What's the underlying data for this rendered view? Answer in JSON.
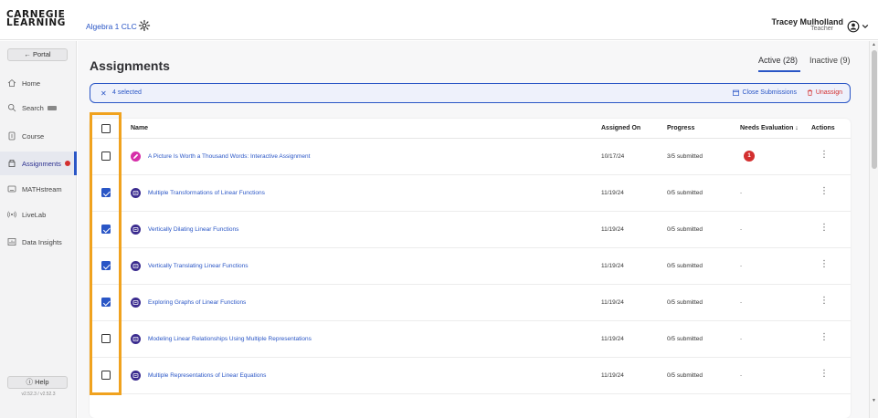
{
  "app": {
    "logo_line1": "CARNEGIE",
    "logo_line2": "LEARNING",
    "course": "Algebra 1 CLC",
    "user_name": "Tracey Mulholland",
    "user_role": "Teacher"
  },
  "sidebar": {
    "portal": "← Portal",
    "items": [
      {
        "label": "Home",
        "icon": "home-icon"
      },
      {
        "label": "Search",
        "icon": "search-icon"
      },
      {
        "label": "Course",
        "icon": "course-icon"
      },
      {
        "label": "Assignments",
        "icon": "assignments-icon",
        "active": true
      },
      {
        "label": "MATHstream",
        "icon": "mathstream-icon"
      },
      {
        "label": "LiveLab",
        "icon": "livelab-icon"
      },
      {
        "label": "Data Insights",
        "icon": "data-insights-icon"
      }
    ],
    "help": "ⓘ Help",
    "version": "v2.52.3 / v2.52.3"
  },
  "main": {
    "title": "Assignments",
    "tabs": [
      {
        "label": "Active (28)",
        "active": true
      },
      {
        "label": "Inactive (9)",
        "active": false
      }
    ],
    "selection": {
      "text": "4 selected",
      "close_label": "Close Submissions",
      "unassign_label": "Unassign"
    },
    "columns": {
      "name": "Name",
      "assigned_on": "Assigned On",
      "progress": "Progress",
      "needs_evaluation": "Needs Evaluation ↓",
      "actions": "Actions"
    },
    "rows": [
      {
        "name": "A Picture Is Worth a Thousand Words: Interactive Assignment",
        "assigned_on": "10/17/24",
        "progress": "3/5 submitted",
        "needs_evaluation": "1",
        "checked": false,
        "icon": "pencil-icon"
      },
      {
        "name": "Multiple Transformations of Linear Functions",
        "assigned_on": "11/19/24",
        "progress": "0/5 submitted",
        "needs_evaluation": "-",
        "checked": true,
        "icon": "lesson-icon"
      },
      {
        "name": "Vertically Dilating Linear Functions",
        "assigned_on": "11/19/24",
        "progress": "0/5 submitted",
        "needs_evaluation": "-",
        "checked": true,
        "icon": "lesson-icon"
      },
      {
        "name": "Vertically Translating Linear Functions",
        "assigned_on": "11/19/24",
        "progress": "0/5 submitted",
        "needs_evaluation": "-",
        "checked": true,
        "icon": "lesson-icon"
      },
      {
        "name": "Exploring Graphs of Linear Functions",
        "assigned_on": "11/19/24",
        "progress": "0/5 submitted",
        "needs_evaluation": "-",
        "checked": true,
        "icon": "lesson-icon"
      },
      {
        "name": "Modeling Linear Relationships Using Multiple Representations",
        "assigned_on": "11/19/24",
        "progress": "0/5 submitted",
        "needs_evaluation": "-",
        "checked": false,
        "icon": "lesson-icon"
      },
      {
        "name": "Multiple Representations of Linear Equations",
        "assigned_on": "11/19/24",
        "progress": "0/5 submitted",
        "needs_evaluation": "-",
        "checked": false,
        "icon": "lesson-icon"
      }
    ],
    "actions_glyph": "⋮"
  },
  "colors": {
    "accent": "#2a56c6",
    "highlight": "#f0a21e",
    "alert": "#d32f2f"
  }
}
